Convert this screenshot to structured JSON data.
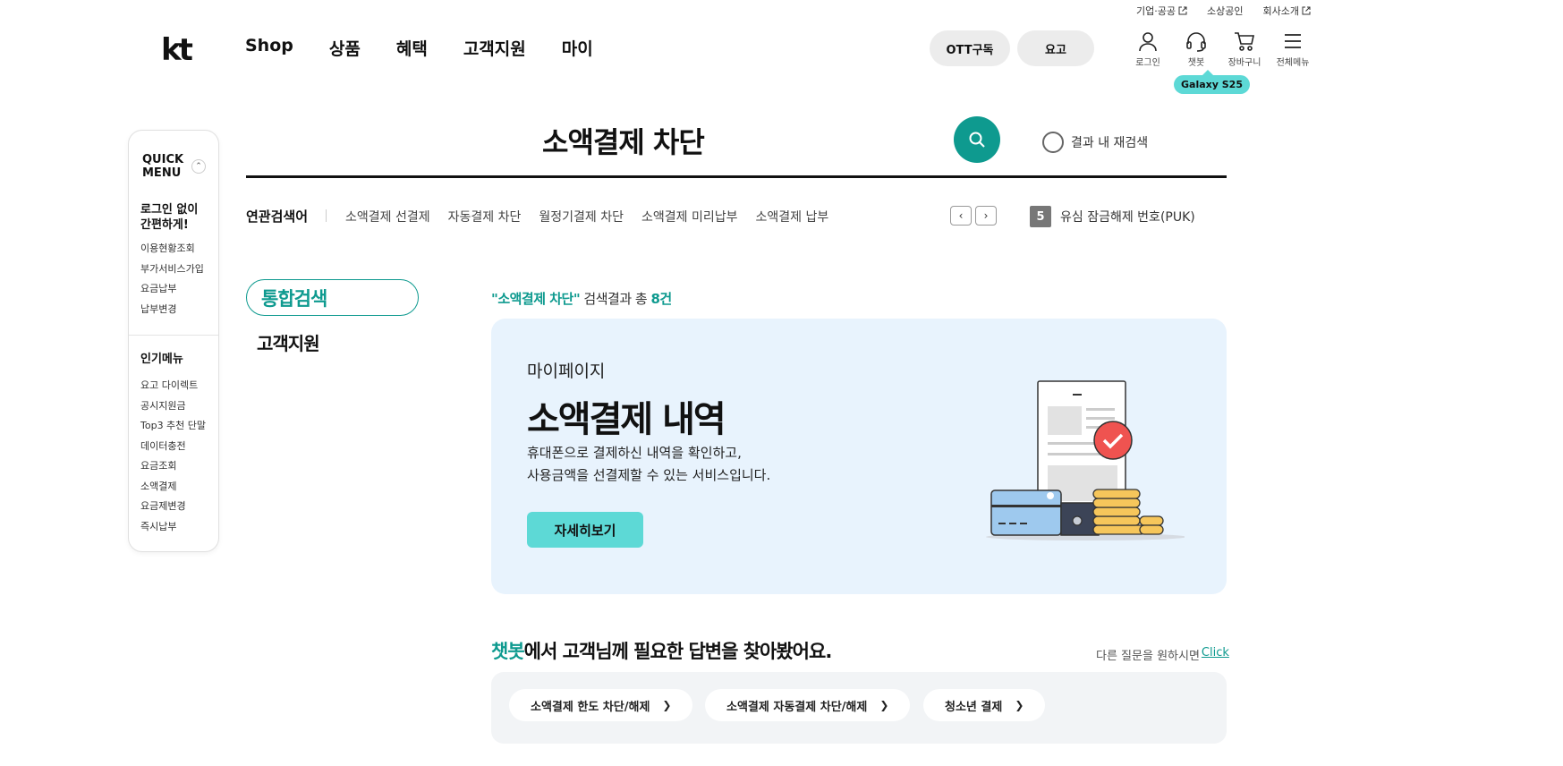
{
  "util_bar": {
    "items": [
      {
        "label": "기업·공공",
        "external": true
      },
      {
        "label": "소상공인",
        "external": false
      },
      {
        "label": "회사소개",
        "external": true
      }
    ]
  },
  "header": {
    "logo": "kt",
    "gnb": [
      "Shop",
      "상품",
      "혜택",
      "고객지원",
      "마이"
    ],
    "pill_ott": "OTT구독",
    "pill_yogo": "요고",
    "icons": [
      {
        "icon": "person-icon",
        "label": "로그인"
      },
      {
        "icon": "headset-icon",
        "label": "챗봇"
      },
      {
        "icon": "cart-icon",
        "label": "장바구니"
      },
      {
        "icon": "menu-icon",
        "label": "전체메뉴"
      }
    ],
    "badge": "Galaxy S25"
  },
  "quick_menu": {
    "title_line1": "QUICK",
    "title_line2": "MENU",
    "login_title_line1": "로그인 없이",
    "login_title_line2": "간편하게!",
    "login_items": [
      "이용현황조회",
      "부가서비스가입",
      "요금납부",
      "납부변경"
    ],
    "popular_title": "인기메뉴",
    "popular_items": [
      "요고 다이렉트",
      "공시지원금",
      "Top3 추천 단말",
      "데이터충전",
      "요금조회",
      "소액결제",
      "요금제변경",
      "즉시납부"
    ]
  },
  "search": {
    "query": "소액결제 차단",
    "re_search_label": "결과 내 재검색"
  },
  "related": {
    "label": "연관검색어",
    "keywords": [
      "소액결제 선결제",
      "자동결제 차단",
      "월정기결제 차단",
      "소액결제 미리납부",
      "소액결제 납부"
    ],
    "rank_number": "5",
    "rank_text": "유심 잠금해제 번호(PUK)"
  },
  "filters": {
    "active": "통합검색",
    "other": "고객지원"
  },
  "result": {
    "query_quoted": "\"소액결제 차단\"",
    "summary_text": " 검색결과 총 ",
    "count": "8건"
  },
  "card": {
    "category": "마이페이지",
    "title": "소액결제 내역",
    "desc_line1": "휴대폰으로 결제하신 내역을 확인하고,",
    "desc_line2": "사용금액을 선결제할 수 있는 서비스입니다.",
    "button": "자세히보기",
    "colors": {
      "background": "#e8f3fd",
      "button": "#5dd9d6",
      "accent": "#0e9a8f"
    }
  },
  "chatbot": {
    "heading_accent": "챗봇",
    "heading_rest": "에서 고객님께 필요한 답변을 찾아봤어요.",
    "more_text": "다른 질문을 원하시면",
    "more_link": "Click",
    "chips": [
      "소액결제 한도 차단/해제",
      "소액결제 자동결제 차단/해제",
      "청소년 결제"
    ]
  }
}
